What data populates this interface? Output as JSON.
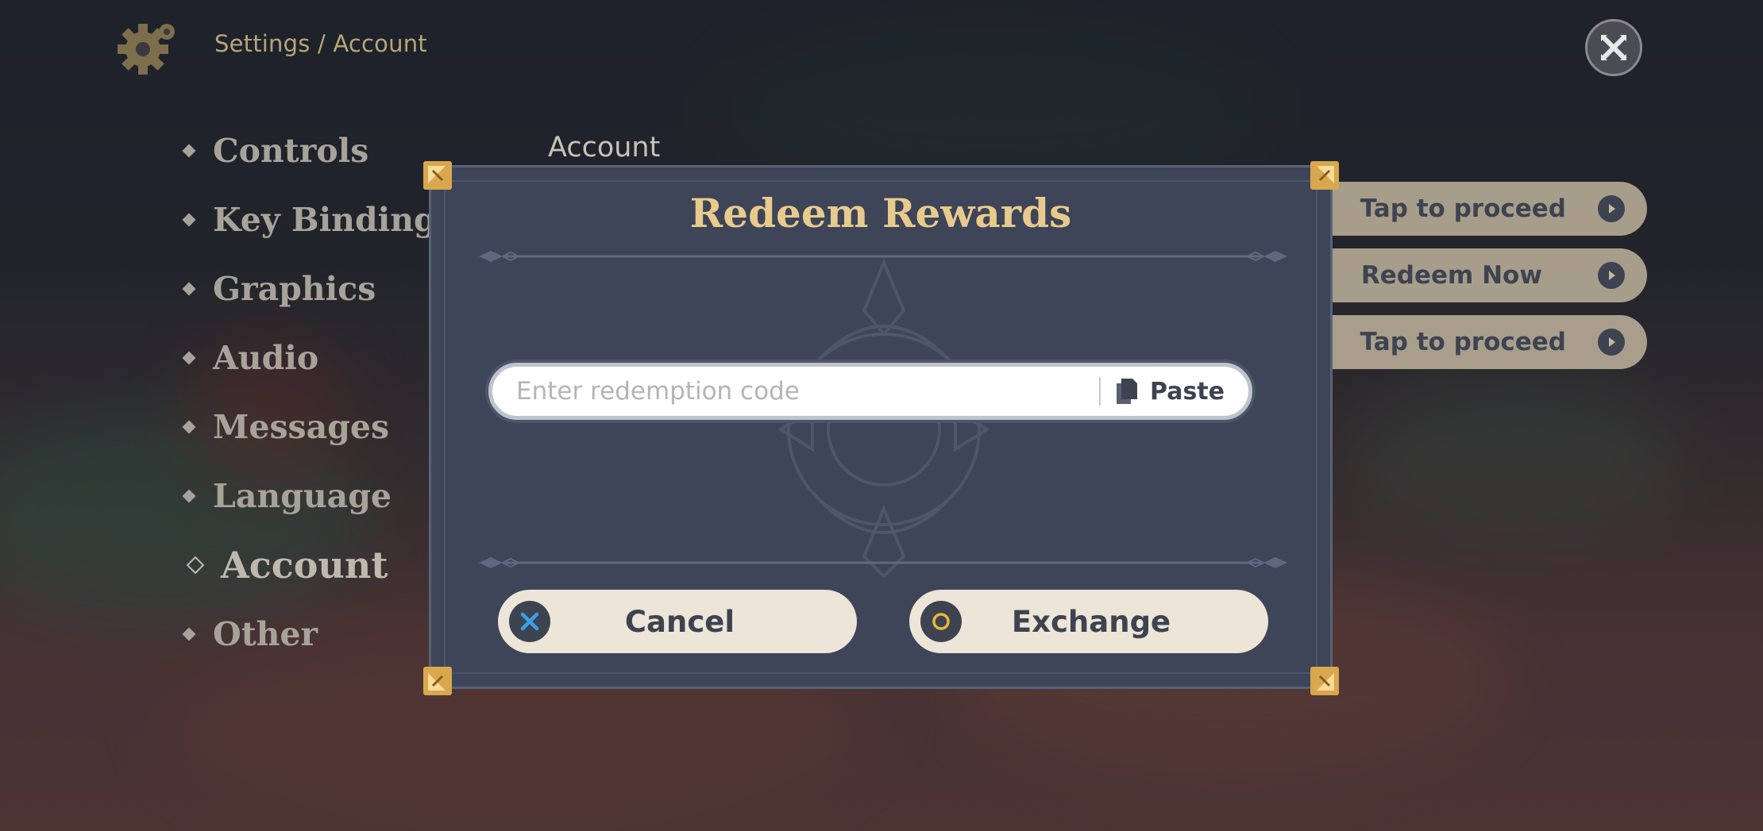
{
  "header": {
    "breadcrumb": "Settings / Account",
    "settings_icon": "gear-icon",
    "close_icon": "close-icon"
  },
  "sidebar": {
    "items": [
      {
        "label": "Controls"
      },
      {
        "label": "Key Bindings"
      },
      {
        "label": "Graphics"
      },
      {
        "label": "Audio"
      },
      {
        "label": "Messages"
      },
      {
        "label": "Language"
      },
      {
        "label": "Account",
        "active": true
      },
      {
        "label": "Other"
      }
    ]
  },
  "main": {
    "section_title": "Account",
    "actions": [
      {
        "label": "Tap to proceed"
      },
      {
        "label": "Redeem Now"
      },
      {
        "label": "Tap to proceed"
      }
    ]
  },
  "dialog": {
    "title": "Redeem Rewards",
    "code_input": {
      "value": "",
      "placeholder": "Enter redemption code"
    },
    "paste_label": "Paste",
    "cancel_label": "Cancel",
    "exchange_label": "Exchange"
  },
  "colors": {
    "title_gold": "#e8cb8c",
    "dialog_bg": "#3e4558",
    "button_bg": "#ece5d8",
    "button_text": "#3d4350",
    "cancel_icon": "#3aa0e8",
    "exchange_icon": "#e6b93a"
  }
}
